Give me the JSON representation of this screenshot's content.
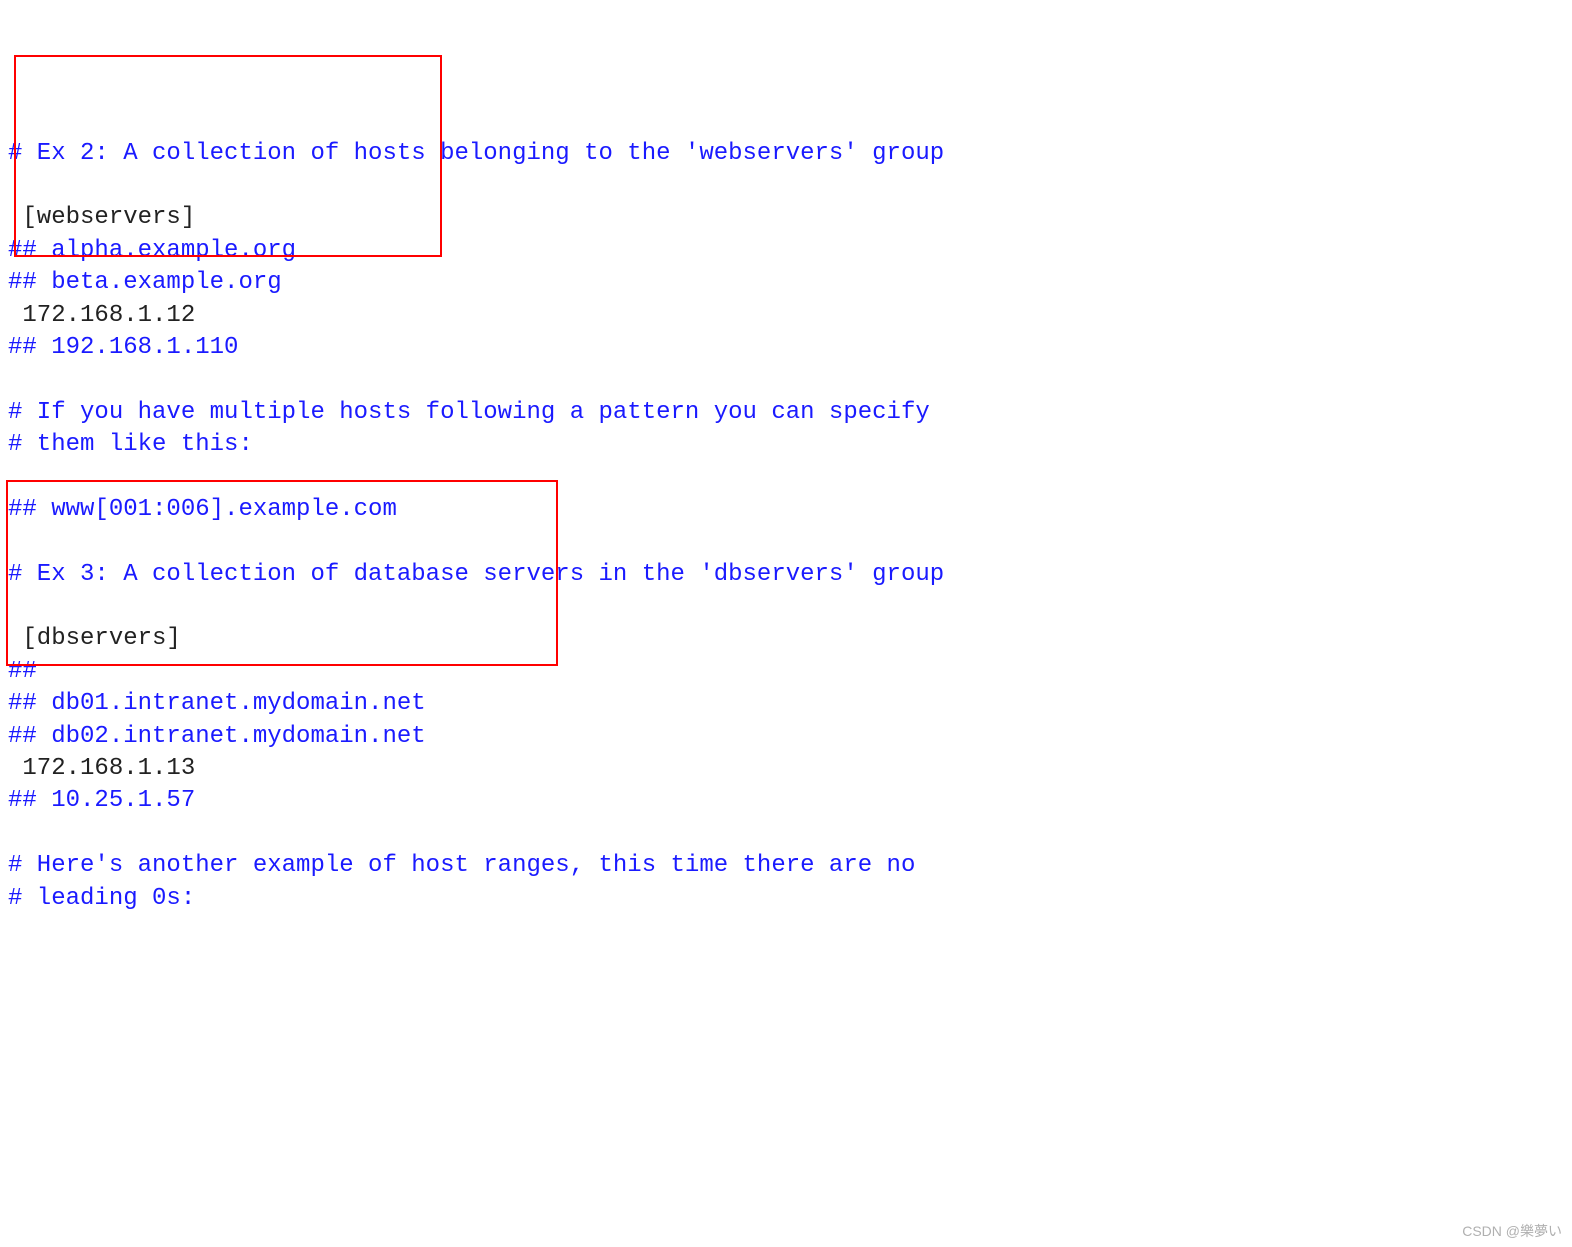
{
  "lines": [
    {
      "type": "comment",
      "text": "# Ex 2: A collection of hosts belonging to the 'webservers' group"
    },
    {
      "type": "blank",
      "text": " "
    },
    {
      "type": "plain",
      "text": " [webservers]"
    },
    {
      "type": "comment",
      "text": "## alpha.example.org"
    },
    {
      "type": "comment",
      "text": "## beta.example.org"
    },
    {
      "type": "plain",
      "text": " 172.168.1.12"
    },
    {
      "type": "comment",
      "text": "## 192.168.1.110"
    },
    {
      "type": "blank",
      "text": " "
    },
    {
      "type": "comment",
      "text": "# If you have multiple hosts following a pattern you can specify"
    },
    {
      "type": "comment",
      "text": "# them like this:"
    },
    {
      "type": "blank",
      "text": " "
    },
    {
      "type": "comment",
      "text": "## www[001:006].example.com"
    },
    {
      "type": "blank",
      "text": " "
    },
    {
      "type": "comment",
      "text": "# Ex 3: A collection of database servers in the 'dbservers' group"
    },
    {
      "type": "blank",
      "text": " "
    },
    {
      "type": "plain",
      "text": " [dbservers]"
    },
    {
      "type": "comment",
      "text": "##"
    },
    {
      "type": "comment",
      "text": "## db01.intranet.mydomain.net"
    },
    {
      "type": "comment",
      "text": "## db02.intranet.mydomain.net"
    },
    {
      "type": "plain",
      "text": " 172.168.1.13"
    },
    {
      "type": "comment",
      "text": "## 10.25.1.57"
    },
    {
      "type": "blank",
      "text": " "
    },
    {
      "type": "comment",
      "text": "# Here's another example of host ranges, this time there are no"
    },
    {
      "type": "comment",
      "text": "# leading 0s:"
    }
  ],
  "watermark": "CSDN @樂夢い"
}
